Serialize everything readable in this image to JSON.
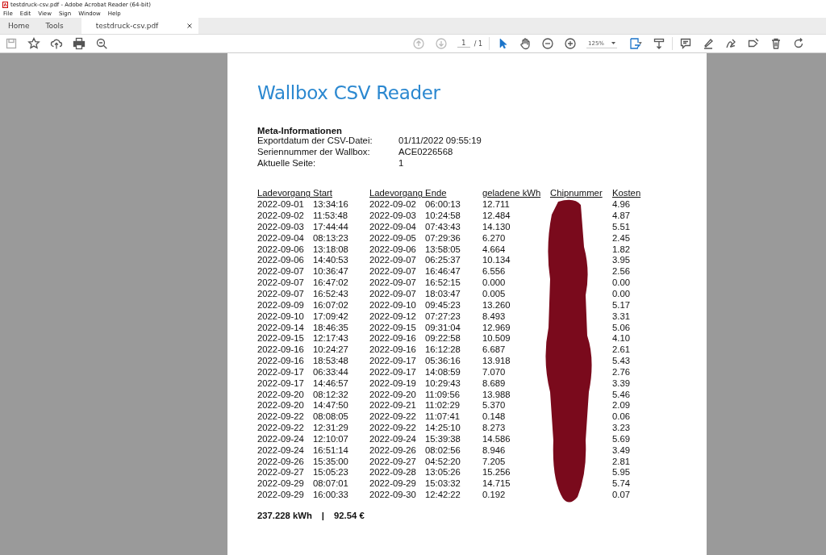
{
  "window": {
    "title": "testdruck-csv.pdf - Adobe Acrobat Reader (64-bit)"
  },
  "menu": [
    "File",
    "Edit",
    "View",
    "Sign",
    "Window",
    "Help"
  ],
  "tabs": [
    {
      "label": "Home",
      "selected": false,
      "kind": "nav"
    },
    {
      "label": "Tools",
      "selected": false,
      "kind": "nav"
    },
    {
      "label": "testdruck-csv.pdf",
      "selected": true,
      "kind": "document"
    }
  ],
  "toolbar": {
    "page": "1",
    "page_total": "/ 1",
    "zoom": "125%"
  },
  "document": {
    "title": "Wallbox CSV Reader",
    "meta_heading": "Meta-Informationen",
    "meta": [
      {
        "label": "Exportdatum der CSV-Datei:",
        "value": "01/11/2022 09:55:19"
      },
      {
        "label": "Seriennummer der Wallbox:",
        "value": "ACE0226568"
      },
      {
        "label": "Aktuelle Seite:",
        "value": "1"
      }
    ],
    "table": {
      "columns": [
        "Ladevorgang Start",
        "Ladevorgang Ende",
        "geladene kWh",
        "Chipnummer",
        "Kosten"
      ],
      "rows": [
        [
          "2022-09-01 13:34:16",
          "2022-09-02 06:00:13",
          "12.711",
          "",
          "4.96"
        ],
        [
          "2022-09-02 11:53:48",
          "2022-09-03 10:24:58",
          "12.484",
          "",
          "4.87"
        ],
        [
          "2022-09-03 17:44:44",
          "2022-09-04 07:43:43",
          "14.130",
          "",
          "5.51"
        ],
        [
          "2022-09-04 08:13:23",
          "2022-09-05 07:29:36",
          "6.270",
          "",
          "2.45"
        ],
        [
          "2022-09-06 13:18:08",
          "2022-09-06 13:58:05",
          "4.664",
          "",
          "1.82"
        ],
        [
          "2022-09-06 14:40:53",
          "2022-09-07 06:25:37",
          "10.134",
          "",
          "3.95"
        ],
        [
          "2022-09-07 10:36:47",
          "2022-09-07 16:46:47",
          "6.556",
          "",
          "2.56"
        ],
        [
          "2022-09-07 16:47:02",
          "2022-09-07 16:52:15",
          "0.000",
          "",
          "0.00"
        ],
        [
          "2022-09-07 16:52:43",
          "2022-09-07 18:03:47",
          "0.005",
          "",
          "0.00"
        ],
        [
          "2022-09-09 16:07:02",
          "2022-09-10 09:45:23",
          "13.260",
          "",
          "5.17"
        ],
        [
          "2022-09-10 17:09:42",
          "2022-09-12 07:27:23",
          "8.493",
          "",
          "3.31"
        ],
        [
          "2022-09-14 18:46:35",
          "2022-09-15 09:31:04",
          "12.969",
          "",
          "5.06"
        ],
        [
          "2022-09-15 12:17:43",
          "2022-09-16 09:22:58",
          "10.509",
          "",
          "4.10"
        ],
        [
          "2022-09-16 10:24:27",
          "2022-09-16 16:12:28",
          "6.687",
          "",
          "2.61"
        ],
        [
          "2022-09-16 18:53:48",
          "2022-09-17 05:36:16",
          "13.918",
          "",
          "5.43"
        ],
        [
          "2022-09-17 06:33:44",
          "2022-09-17 14:08:59",
          "7.070",
          "",
          "2.76"
        ],
        [
          "2022-09-17 14:46:57",
          "2022-09-19 10:29:43",
          "8.689",
          "",
          "3.39"
        ],
        [
          "2022-09-20 08:12:32",
          "2022-09-20 11:09:56",
          "13.988",
          "",
          "5.46"
        ],
        [
          "2022-09-20 14:47:50",
          "2022-09-21 11:02:29",
          "5.370",
          "",
          "2.09"
        ],
        [
          "2022-09-22 08:08:05",
          "2022-09-22 11:07:41",
          "0.148",
          "",
          "0.06"
        ],
        [
          "2022-09-22 12:31:29",
          "2022-09-22 14:25:10",
          "8.273",
          "",
          "3.23"
        ],
        [
          "2022-09-24 12:10:07",
          "2022-09-24 15:39:38",
          "14.586",
          "",
          "5.69"
        ],
        [
          "2022-09-24 16:51:14",
          "2022-09-26 08:02:56",
          "8.946",
          "",
          "3.49"
        ],
        [
          "2022-09-26 15:35:00",
          "2022-09-27 04:52:20",
          "7.205",
          "",
          "2.81"
        ],
        [
          "2022-09-27 15:05:23",
          "2022-09-28 13:05:26",
          "15.256",
          "",
          "5.95"
        ],
        [
          "2022-09-29 08:07:01",
          "2022-09-29 15:03:32",
          "14.715",
          "",
          "5.74"
        ],
        [
          "2022-09-29 16:00:33",
          "2022-09-30 12:42:22",
          "0.192",
          "",
          "0.07"
        ]
      ]
    },
    "total_kwh": "237.228 kWh",
    "separator": "|",
    "total_cost": "92.54 €"
  }
}
